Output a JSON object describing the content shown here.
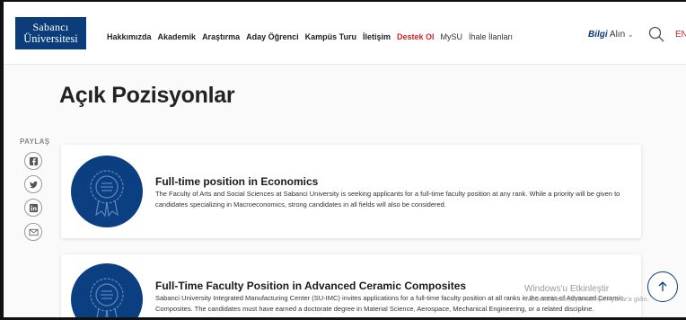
{
  "header": {
    "logo": {
      "line1": "Sabancı",
      "line2": "Üniversitesi",
      "color": "#0b3d7a"
    },
    "nav": [
      {
        "label": "Hakkımızda",
        "style": "bold"
      },
      {
        "label": "Akademik",
        "style": "bold"
      },
      {
        "label": "Araştırma",
        "style": "bold"
      },
      {
        "label": "Aday Öğrenci",
        "style": "bold"
      },
      {
        "label": "Kampüs Turu",
        "style": "bold"
      },
      {
        "label": "İletişim",
        "style": "bold"
      },
      {
        "label": "Destek Ol",
        "style": "red"
      },
      {
        "label": "MySU",
        "style": "light"
      },
      {
        "label": "İhale İlanları",
        "style": "light"
      }
    ],
    "bilgi_bold": "Bilgi",
    "bilgi_rest": "Alın",
    "language": "EN",
    "accent_red": "#d2232a"
  },
  "page": {
    "title": "Açık Pozisyonlar"
  },
  "share": {
    "label": "PAYLAŞ",
    "buttons": [
      {
        "name": "facebook-icon"
      },
      {
        "name": "twitter-icon"
      },
      {
        "name": "linkedin-icon"
      },
      {
        "name": "mail-icon"
      }
    ]
  },
  "positions": [
    {
      "title": "Full-time position in Economics",
      "description": "The Faculty of Arts and Social Sciences at Sabanci University is seeking applicants for a full-time faculty position at any rank. While a priority will be given to candidates specializing in Macroeconomics, strong candidates in all fields will also be considered."
    },
    {
      "title": "Full-Time Faculty Position in Advanced Ceramic Composites",
      "description": "Sabanci University Integrated Manufacturing Center (SU-IMC) invites applications for a full-time faculty position at all ranks in the areas of Advanced Ceramic Composites. The candidates must have earned a doctorate degree in Material Science, Aerospace, Mechanical Engineering, or a related discipline."
    }
  ],
  "overlay": {
    "watermark": "Windows'u Etkinleştir",
    "watermark_sub": "Windows'u etkinleştirmek için Ayarlar'a gidin."
  }
}
